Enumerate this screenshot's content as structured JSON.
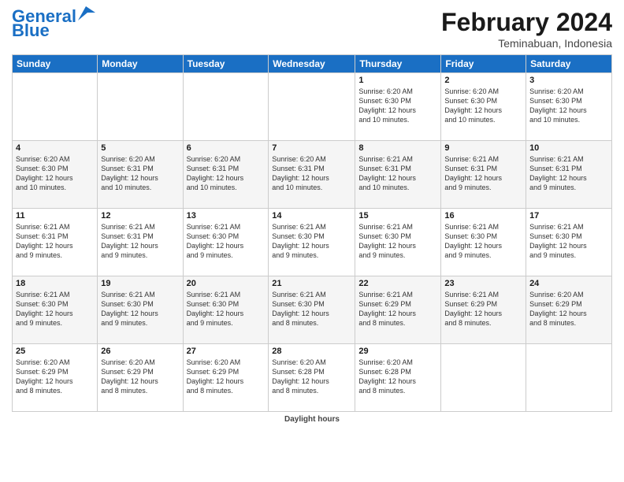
{
  "header": {
    "logo_line1": "General",
    "logo_line2": "Blue",
    "month_title": "February 2024",
    "subtitle": "Teminabuan, Indonesia"
  },
  "days_of_week": [
    "Sunday",
    "Monday",
    "Tuesday",
    "Wednesday",
    "Thursday",
    "Friday",
    "Saturday"
  ],
  "weeks": [
    [
      {
        "day": "",
        "info": ""
      },
      {
        "day": "",
        "info": ""
      },
      {
        "day": "",
        "info": ""
      },
      {
        "day": "",
        "info": ""
      },
      {
        "day": "1",
        "info": "Sunrise: 6:20 AM\nSunset: 6:30 PM\nDaylight: 12 hours\nand 10 minutes."
      },
      {
        "day": "2",
        "info": "Sunrise: 6:20 AM\nSunset: 6:30 PM\nDaylight: 12 hours\nand 10 minutes."
      },
      {
        "day": "3",
        "info": "Sunrise: 6:20 AM\nSunset: 6:30 PM\nDaylight: 12 hours\nand 10 minutes."
      }
    ],
    [
      {
        "day": "4",
        "info": "Sunrise: 6:20 AM\nSunset: 6:30 PM\nDaylight: 12 hours\nand 10 minutes."
      },
      {
        "day": "5",
        "info": "Sunrise: 6:20 AM\nSunset: 6:31 PM\nDaylight: 12 hours\nand 10 minutes."
      },
      {
        "day": "6",
        "info": "Sunrise: 6:20 AM\nSunset: 6:31 PM\nDaylight: 12 hours\nand 10 minutes."
      },
      {
        "day": "7",
        "info": "Sunrise: 6:20 AM\nSunset: 6:31 PM\nDaylight: 12 hours\nand 10 minutes."
      },
      {
        "day": "8",
        "info": "Sunrise: 6:21 AM\nSunset: 6:31 PM\nDaylight: 12 hours\nand 10 minutes."
      },
      {
        "day": "9",
        "info": "Sunrise: 6:21 AM\nSunset: 6:31 PM\nDaylight: 12 hours\nand 9 minutes."
      },
      {
        "day": "10",
        "info": "Sunrise: 6:21 AM\nSunset: 6:31 PM\nDaylight: 12 hours\nand 9 minutes."
      }
    ],
    [
      {
        "day": "11",
        "info": "Sunrise: 6:21 AM\nSunset: 6:31 PM\nDaylight: 12 hours\nand 9 minutes."
      },
      {
        "day": "12",
        "info": "Sunrise: 6:21 AM\nSunset: 6:31 PM\nDaylight: 12 hours\nand 9 minutes."
      },
      {
        "day": "13",
        "info": "Sunrise: 6:21 AM\nSunset: 6:30 PM\nDaylight: 12 hours\nand 9 minutes."
      },
      {
        "day": "14",
        "info": "Sunrise: 6:21 AM\nSunset: 6:30 PM\nDaylight: 12 hours\nand 9 minutes."
      },
      {
        "day": "15",
        "info": "Sunrise: 6:21 AM\nSunset: 6:30 PM\nDaylight: 12 hours\nand 9 minutes."
      },
      {
        "day": "16",
        "info": "Sunrise: 6:21 AM\nSunset: 6:30 PM\nDaylight: 12 hours\nand 9 minutes."
      },
      {
        "day": "17",
        "info": "Sunrise: 6:21 AM\nSunset: 6:30 PM\nDaylight: 12 hours\nand 9 minutes."
      }
    ],
    [
      {
        "day": "18",
        "info": "Sunrise: 6:21 AM\nSunset: 6:30 PM\nDaylight: 12 hours\nand 9 minutes."
      },
      {
        "day": "19",
        "info": "Sunrise: 6:21 AM\nSunset: 6:30 PM\nDaylight: 12 hours\nand 9 minutes."
      },
      {
        "day": "20",
        "info": "Sunrise: 6:21 AM\nSunset: 6:30 PM\nDaylight: 12 hours\nand 9 minutes."
      },
      {
        "day": "21",
        "info": "Sunrise: 6:21 AM\nSunset: 6:30 PM\nDaylight: 12 hours\nand 8 minutes."
      },
      {
        "day": "22",
        "info": "Sunrise: 6:21 AM\nSunset: 6:29 PM\nDaylight: 12 hours\nand 8 minutes."
      },
      {
        "day": "23",
        "info": "Sunrise: 6:21 AM\nSunset: 6:29 PM\nDaylight: 12 hours\nand 8 minutes."
      },
      {
        "day": "24",
        "info": "Sunrise: 6:20 AM\nSunset: 6:29 PM\nDaylight: 12 hours\nand 8 minutes."
      }
    ],
    [
      {
        "day": "25",
        "info": "Sunrise: 6:20 AM\nSunset: 6:29 PM\nDaylight: 12 hours\nand 8 minutes."
      },
      {
        "day": "26",
        "info": "Sunrise: 6:20 AM\nSunset: 6:29 PM\nDaylight: 12 hours\nand 8 minutes."
      },
      {
        "day": "27",
        "info": "Sunrise: 6:20 AM\nSunset: 6:29 PM\nDaylight: 12 hours\nand 8 minutes."
      },
      {
        "day": "28",
        "info": "Sunrise: 6:20 AM\nSunset: 6:28 PM\nDaylight: 12 hours\nand 8 minutes."
      },
      {
        "day": "29",
        "info": "Sunrise: 6:20 AM\nSunset: 6:28 PM\nDaylight: 12 hours\nand 8 minutes."
      },
      {
        "day": "",
        "info": ""
      },
      {
        "day": "",
        "info": ""
      }
    ]
  ],
  "footer": {
    "label": "Daylight hours"
  }
}
